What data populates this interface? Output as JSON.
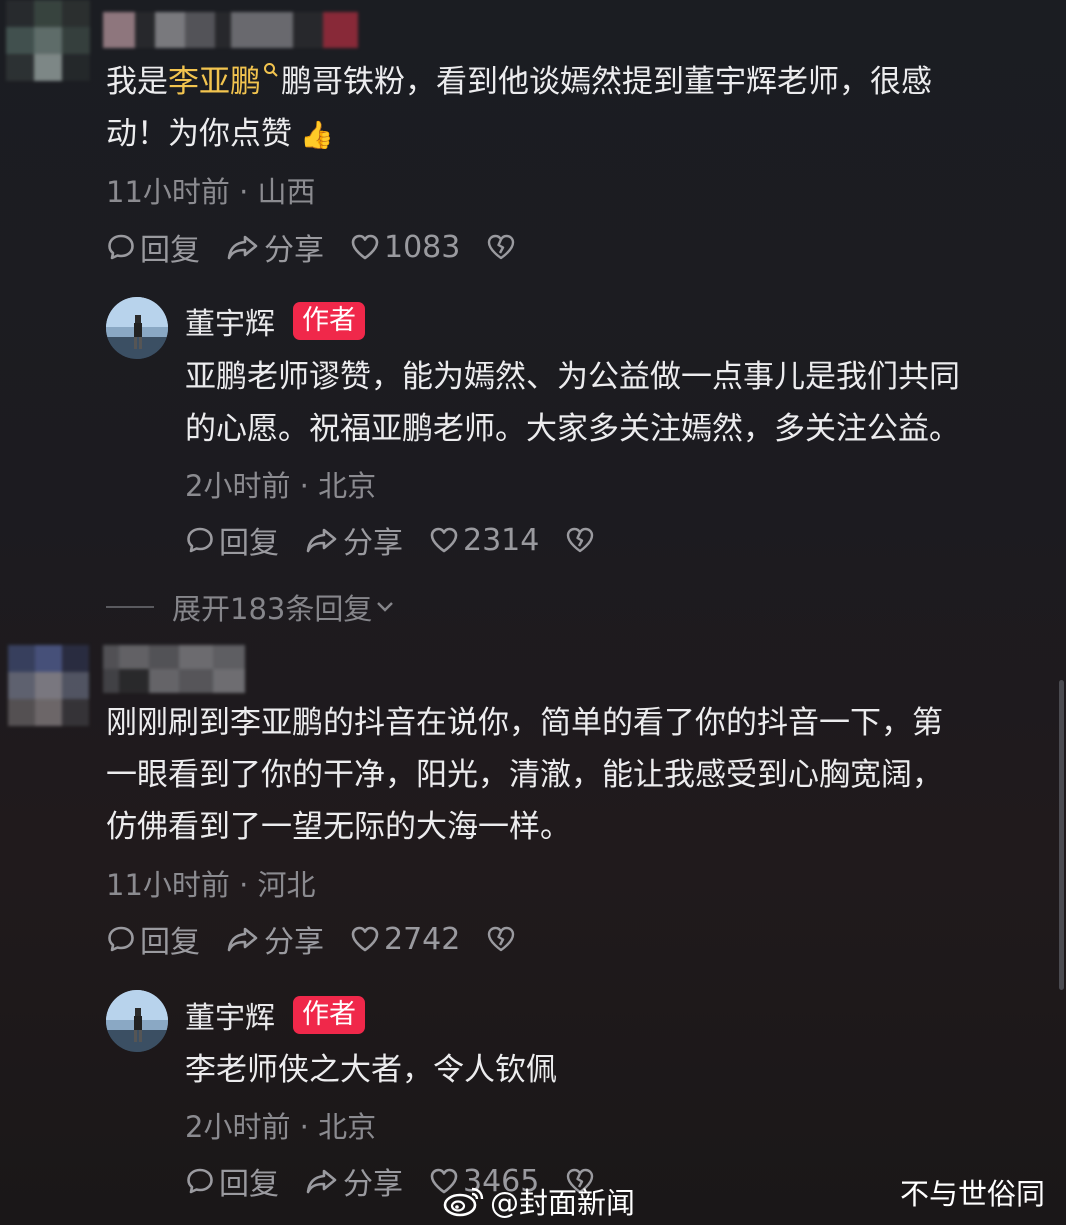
{
  "comments": [
    {
      "text_before": "我是",
      "highlight": "李亚鹏",
      "text_after_line1": "鹏哥铁粉，看到他谈嫣然提到董宇辉老师，很感",
      "line2": "动！为你点赞",
      "emoji": "👍",
      "meta": "11小时前 · 山西",
      "reply_label": "回复",
      "share_label": "分享",
      "likes": "1083",
      "reply": {
        "name": "董宇辉",
        "badge": "作者",
        "line1": "亚鹏老师谬赞，能为嫣然、为公益做一点事儿是我们共同",
        "line2": "的心愿。祝福亚鹏老师。大家多关注嫣然，多关注公益。",
        "meta": "2小时前 · 北京",
        "reply_label": "回复",
        "share_label": "分享",
        "likes": "2314"
      },
      "expand_label": "展开183条回复"
    },
    {
      "line1": "刚刚刷到李亚鹏的抖音在说你，简单的看了你的抖音一下，第",
      "line2": "一眼看到了你的干净，阳光，清澈，能让我感受到心胸宽阔，",
      "line3": "仿佛看到了一望无际的大海一样。",
      "meta": "11小时前 · 河北",
      "reply_label": "回复",
      "share_label": "分享",
      "likes": "2742",
      "reply": {
        "name": "董宇辉",
        "badge": "作者",
        "line1": "李老师侠之大者，令人钦佩",
        "meta": "2小时前 · 北京",
        "reply_label": "回复",
        "share_label": "分享",
        "likes": "3465"
      }
    }
  ],
  "watermarks": {
    "weibo": "@封面新闻",
    "source": "不与世俗同"
  },
  "icons": [
    "comment-bubble-icon",
    "share-arrow-icon",
    "heart-icon",
    "broken-heart-icon",
    "search-icon",
    "chevron-down-icon",
    "weibo-logo-icon"
  ],
  "colors": {
    "highlight": "#f2c44f",
    "badge": "#f0284a",
    "meta": "#8b8b90"
  }
}
